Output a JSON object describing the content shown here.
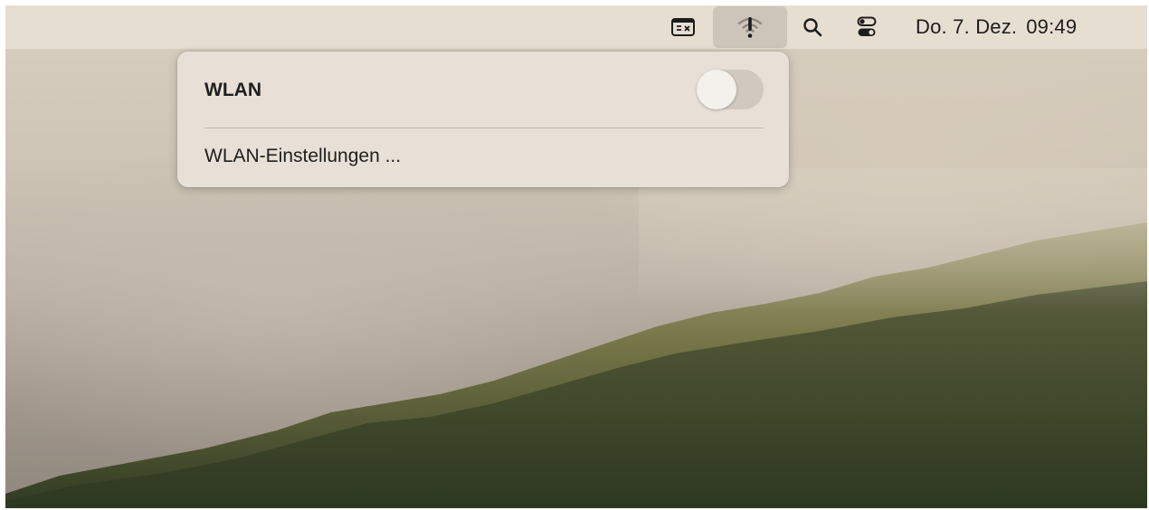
{
  "menubar": {
    "icons": [
      "input-source-icon",
      "wifi-alert-icon",
      "search-icon",
      "control-center-icon"
    ],
    "clock": {
      "date": "Do. 7. Dez.",
      "time": "09:49"
    }
  },
  "wifi_menu": {
    "title": "WLAN",
    "toggle_on": false,
    "settings_label": "WLAN-Einstellungen ..."
  }
}
